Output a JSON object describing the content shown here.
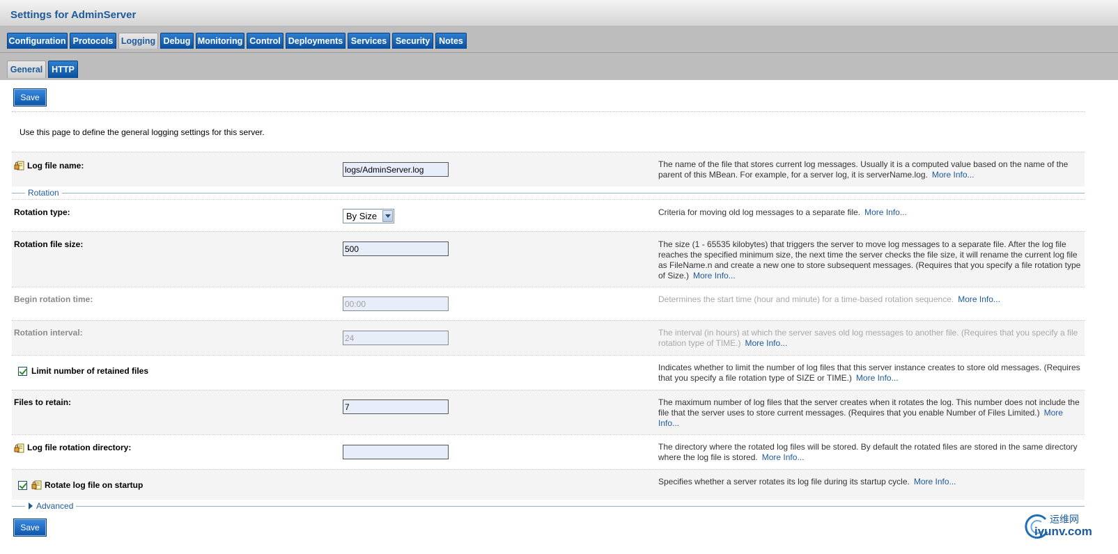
{
  "page": {
    "title": "Settings for AdminServer"
  },
  "tabs": [
    {
      "label": "Configuration",
      "active": false
    },
    {
      "label": "Protocols",
      "active": false
    },
    {
      "label": "Logging",
      "active": true
    },
    {
      "label": "Debug",
      "active": false
    },
    {
      "label": "Monitoring",
      "active": false
    },
    {
      "label": "Control",
      "active": false
    },
    {
      "label": "Deployments",
      "active": false
    },
    {
      "label": "Services",
      "active": false
    },
    {
      "label": "Security",
      "active": false
    },
    {
      "label": "Notes",
      "active": false
    }
  ],
  "subtabs": [
    {
      "label": "General",
      "active": true
    },
    {
      "label": "HTTP",
      "active": false
    }
  ],
  "buttons": {
    "save_top": "Save",
    "save_bottom": "Save"
  },
  "intro": "Use this page to define the general logging settings for this server.",
  "more_info": "More Info...",
  "fields": {
    "log_file_name": {
      "label": "Log file name:",
      "value": "logs/AdminServer.log",
      "desc": "The name of the file that stores current log messages. Usually it is a computed value based on the name of the parent of this MBean. For example, for a server log, it is serverName.log."
    },
    "rotation_type": {
      "label": "Rotation type:",
      "value": "By Size",
      "desc": "Criteria for moving old log messages to a separate file."
    },
    "rotation_file_size": {
      "label": "Rotation file size:",
      "value": "500",
      "desc": "The size (1 - 65535 kilobytes) that triggers the server to move log messages to a separate file. After the log file reaches the specified minimum size, the next time the server checks the file size, it will rename the current log file as FileName.n and create a new one to store subsequent messages. (Requires that you specify a file rotation type of Size.)"
    },
    "begin_rotation_time": {
      "label": "Begin rotation time:",
      "value": "00:00",
      "desc": "Determines the start time (hour and minute) for a time-based rotation sequence."
    },
    "rotation_interval": {
      "label": "Rotation interval:",
      "value": "24",
      "desc": "The interval (in hours) at which the server saves old log messages to another file. (Requires that you specify a file rotation type of TIME.)"
    },
    "limit_retained": {
      "label": "Limit number of retained files",
      "checked": true,
      "desc": "Indicates whether to limit the number of log files that this server instance creates to store old messages. (Requires that you specify a file rotation type of SIZE or TIME.)"
    },
    "files_to_retain": {
      "label": "Files to retain:",
      "value": "7",
      "desc": "The maximum number of log files that the server creates when it rotates the log. This number does not include the file that the server uses to store current messages. (Requires that you enable Number of Files Limited.)"
    },
    "log_file_rotation_dir": {
      "label": "Log file rotation directory:",
      "value": "",
      "desc": "The directory where the rotated log files will be stored. By default the rotated files are stored in the same directory where the log file is stored."
    },
    "rotate_on_startup": {
      "label": "Rotate log file on startup",
      "checked": true,
      "desc": "Specifies whether a server rotates its log file during its startup cycle."
    }
  },
  "sections": {
    "rotation": "Rotation",
    "advanced": "Advanced"
  },
  "watermark": {
    "cn": "运维网",
    "en": "iyunv.com"
  },
  "colors": {
    "tab_blue": "#0b4f9e",
    "title_blue": "#1d5a9b",
    "field_bg": "#e8eef9",
    "bar_gray": "#bdbdbd"
  }
}
